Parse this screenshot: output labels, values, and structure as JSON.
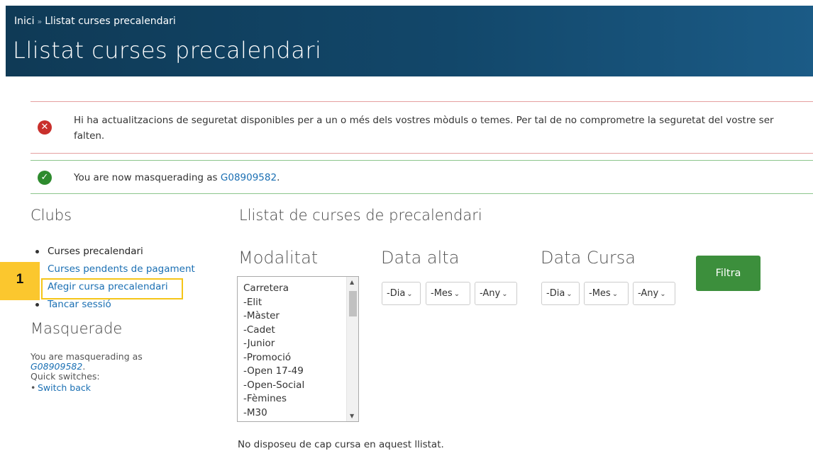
{
  "header": {
    "breadcrumb": {
      "home": "Inici",
      "separator": "»",
      "current": "Llistat curses precalendari"
    },
    "title": "Llistat curses precalendari"
  },
  "messages": {
    "error": {
      "line1": "Hi ha actualitzacions de seguretat disponibles per a un o més dels vostres mòduls o temes. Per tal de no comprometre la seguretat del vostre ser",
      "line2": "falten."
    },
    "status": {
      "prefix": "You are now masquerading as ",
      "user": "G08909582",
      "suffix": "."
    }
  },
  "sidebar": {
    "clubs_heading": "Clubs",
    "items": [
      {
        "label": "Curses precalendari"
      },
      {
        "label": "Curses pendents de pagament"
      },
      {
        "label": "Afegir cursa precalendari"
      },
      {
        "label": "Tancar sessió"
      }
    ],
    "masquerade_heading": "Masquerade",
    "masquerade": {
      "text": "You are masquerading as",
      "user": "G08909582",
      "quick_switches": "Quick switches:",
      "switch_back": "Switch back"
    }
  },
  "annotation": {
    "step": "1"
  },
  "main": {
    "heading": "Llistat de curses de precalendari",
    "filters": {
      "modalitat_label": "Modalitat",
      "data_alta_label": "Data alta",
      "data_cursa_label": "Data Cursa",
      "modalitat_options": [
        "Carretera",
        "-Elit",
        "-Màster",
        "-Cadet",
        "-Junior",
        "-Promoció",
        "-Open 17-49",
        "-Open-Social",
        "-Fèmines",
        "-M30"
      ],
      "day_placeholder": "-Dia",
      "month_placeholder": "-Mes",
      "year_placeholder": "-Any",
      "filter_button": "Filtra"
    },
    "empty_message": "No disposeu de cap cursa en aquest llistat."
  },
  "colors": {
    "header": "#12476a",
    "link": "#1a6fb3",
    "button": "#3c8f3c",
    "highlight": "#f5c518",
    "error": "#c9302c",
    "success": "#2e8b2e"
  }
}
